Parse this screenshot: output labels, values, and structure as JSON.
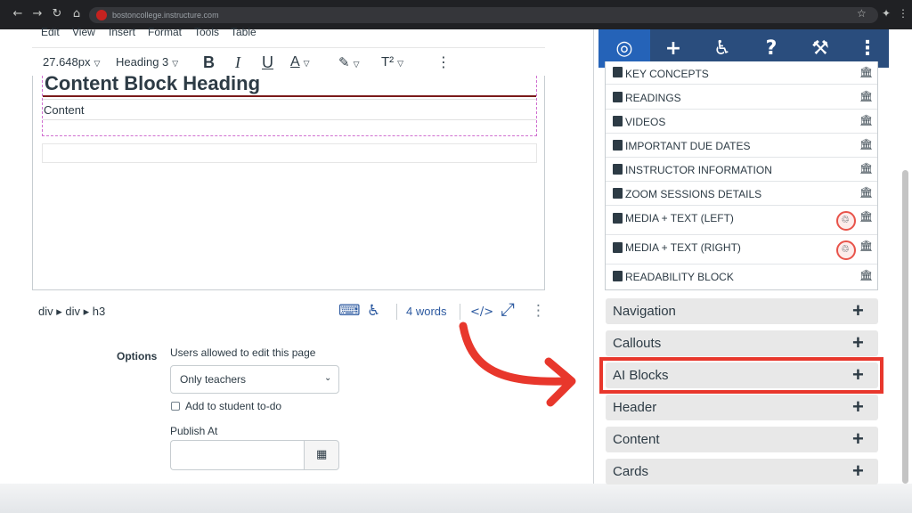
{
  "browser": {
    "url": "bostoncollege.instructure.com",
    "back_icon": "←",
    "forward_icon": "→",
    "reload_icon": "↻",
    "home_icon": "⌂",
    "star_icon": "☆",
    "extensions_icon": "✦",
    "menu_icon": "⋮"
  },
  "menubar": {
    "items": [
      "Edit",
      "View",
      "Insert",
      "Format",
      "Tools",
      "Table"
    ]
  },
  "toolbar": {
    "font_size": "27.648px",
    "block_format": "Heading 3",
    "bold": "B",
    "italic": "I",
    "underline": "U",
    "text_color": "A",
    "highlight": "✎",
    "superscript": "T²",
    "more": "⋮"
  },
  "editor": {
    "heading": "Content Block Heading",
    "content": "Content",
    "heading_rule_color": "#7a1a1a",
    "block_outline_color": "#d06fd0"
  },
  "statusbar": {
    "path": "div ▸ div ▸ h3",
    "word_count": "4 words",
    "html_toggle": "</>",
    "fullscreen": "⤢",
    "drag_handle": "⋮"
  },
  "options": {
    "label": "Options",
    "users_allowed_label": "Users allowed to edit this page",
    "users_allowed_value": "Only teachers",
    "add_todo_label": "Add to student to-do",
    "add_todo_checked": false,
    "publish_at_label": "Publish At",
    "publish_at_value": ""
  },
  "sidebar": {
    "header_icons": [
      "target-icon",
      "plus-icon",
      "accessibility-icon",
      "help-icon",
      "tools-icon",
      "more-icon"
    ],
    "active_color": "#2563b8",
    "header_color": "#2a4d7d",
    "items": [
      {
        "label": "KEY CONCEPTS",
        "badge": false
      },
      {
        "label": "READINGS",
        "badge": false
      },
      {
        "label": "VIDEOS",
        "badge": false
      },
      {
        "label": "IMPORTANT DUE DATES",
        "badge": false
      },
      {
        "label": "INSTRUCTOR INFORMATION",
        "badge": false
      },
      {
        "label": "ZOOM SESSIONS DETAILS",
        "badge": false
      },
      {
        "label": "MEDIA + TEXT (LEFT)",
        "badge": true
      },
      {
        "label": "MEDIA + TEXT (RIGHT)",
        "badge": true
      },
      {
        "label": "READABILITY BLOCK",
        "badge": false
      }
    ],
    "sections": [
      {
        "label": "Navigation"
      },
      {
        "label": "Callouts"
      },
      {
        "label": "AI Blocks",
        "highlighted": true
      },
      {
        "label": "Header"
      },
      {
        "label": "Content"
      },
      {
        "label": "Cards"
      }
    ],
    "section_toggle": "+"
  },
  "annotation": {
    "color": "#e8372c"
  }
}
